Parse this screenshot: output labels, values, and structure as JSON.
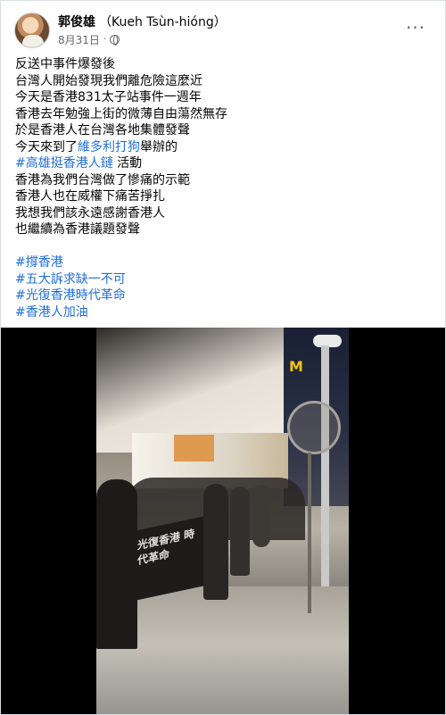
{
  "post": {
    "author": "郭俊雄",
    "author_translit": "（Kueh Tsùn-hióng）",
    "date": "8月31日",
    "separator": "·",
    "privacy_icon": "globe-icon",
    "more_icon": "more-icon",
    "more_label": "···"
  },
  "body": {
    "lines": [
      "反送中事件爆發後",
      "台灣人開始發現我們離危險這麼近",
      "今天是香港831太子站事件一週年",
      "香港去年勉強上街的微薄自由蕩然無存",
      "於是香港人在台灣各地集體發聲"
    ],
    "line6_prefix": "今天來到了",
    "line6_link": "維多利打狗",
    "line6_suffix": "舉辦的",
    "line7_link": "#高雄挺香港人鏈",
    "line7_suffix": " 活動",
    "lines_after": [
      "香港為我們台灣做了慘痛的示範",
      "香港人也在威權下痛苦掙扎",
      "我想我們該永遠感謝香港人",
      "也繼續為香港議題發聲"
    ],
    "hashtags": [
      "#撐香港",
      "#五大訴求缺一不可",
      "#光復香港時代革命",
      "#香港人加油"
    ]
  },
  "media": {
    "sign_text": "M",
    "banner_text": "光復香港 時代革命"
  },
  "colors": {
    "link": "#216fdb",
    "text": "#050505",
    "meta": "#65676b"
  }
}
